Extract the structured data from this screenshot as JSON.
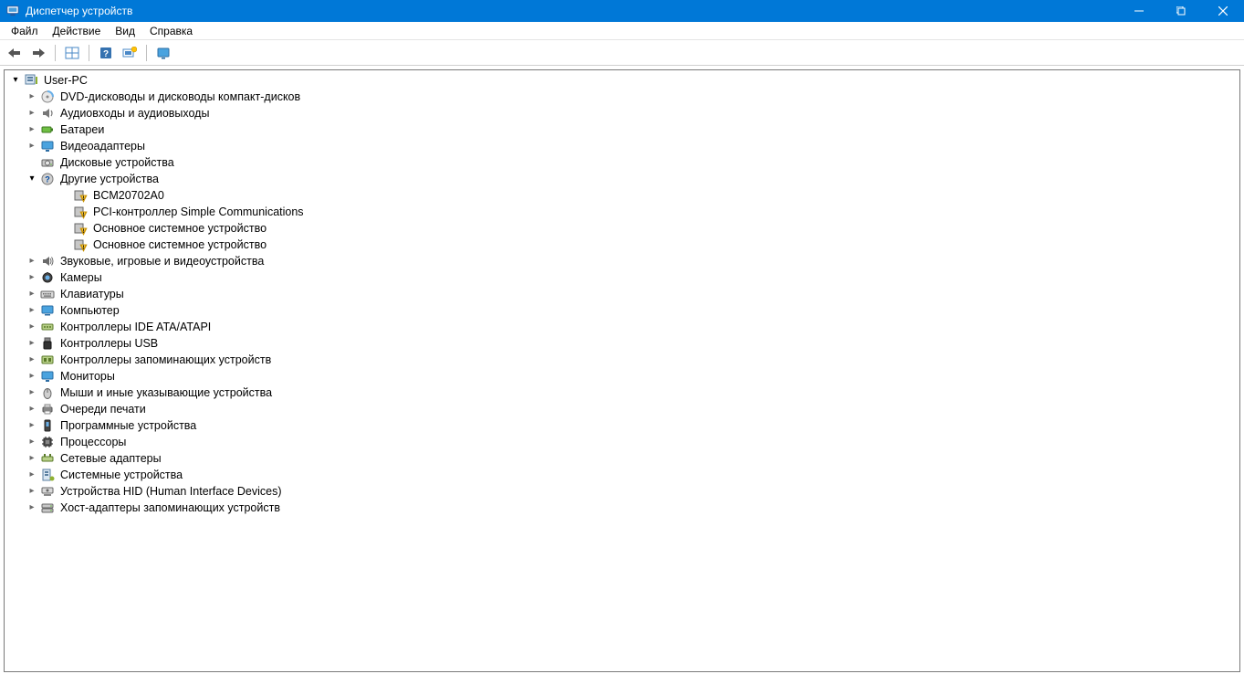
{
  "window": {
    "title": "Диспетчер устройств"
  },
  "menu": {
    "file": "Файл",
    "action": "Действие",
    "view": "Вид",
    "help": "Справка"
  },
  "tree": {
    "root": "User-PC",
    "categories": [
      {
        "label": "DVD-дисководы и дисководы компакт-дисков",
        "icon": "disc"
      },
      {
        "label": "Аудиовходы и аудиовыходы",
        "icon": "audio"
      },
      {
        "label": "Батареи",
        "icon": "battery"
      },
      {
        "label": "Видеоадаптеры",
        "icon": "display"
      },
      {
        "label": "Дисковые устройства",
        "icon": "drive",
        "noexpand": true
      },
      {
        "label": "Другие устройства",
        "icon": "unknown",
        "expanded": true,
        "children": [
          {
            "label": "BCM20702A0"
          },
          {
            "label": "PCI-контроллер Simple Communications"
          },
          {
            "label": "Основное системное устройство"
          },
          {
            "label": "Основное системное устройство"
          }
        ]
      },
      {
        "label": "Звуковые, игровые и видеоустройства",
        "icon": "sound"
      },
      {
        "label": "Камеры",
        "icon": "camera"
      },
      {
        "label": "Клавиатуры",
        "icon": "keyboard"
      },
      {
        "label": "Компьютер",
        "icon": "computer"
      },
      {
        "label": "Контроллеры IDE ATA/ATAPI",
        "icon": "ide"
      },
      {
        "label": "Контроллеры USB",
        "icon": "usb"
      },
      {
        "label": "Контроллеры запоминающих устройств",
        "icon": "storage-ctrl"
      },
      {
        "label": "Мониторы",
        "icon": "monitor"
      },
      {
        "label": "Мыши и иные указывающие устройства",
        "icon": "mouse"
      },
      {
        "label": "Очереди печати",
        "icon": "printer"
      },
      {
        "label": "Программные устройства",
        "icon": "software"
      },
      {
        "label": "Процессоры",
        "icon": "cpu"
      },
      {
        "label": "Сетевые адаптеры",
        "icon": "network"
      },
      {
        "label": "Системные устройства",
        "icon": "system"
      },
      {
        "label": "Устройства HID (Human Interface Devices)",
        "icon": "hid"
      },
      {
        "label": "Хост-адаптеры запоминающих устройств",
        "icon": "host-storage"
      }
    ]
  }
}
